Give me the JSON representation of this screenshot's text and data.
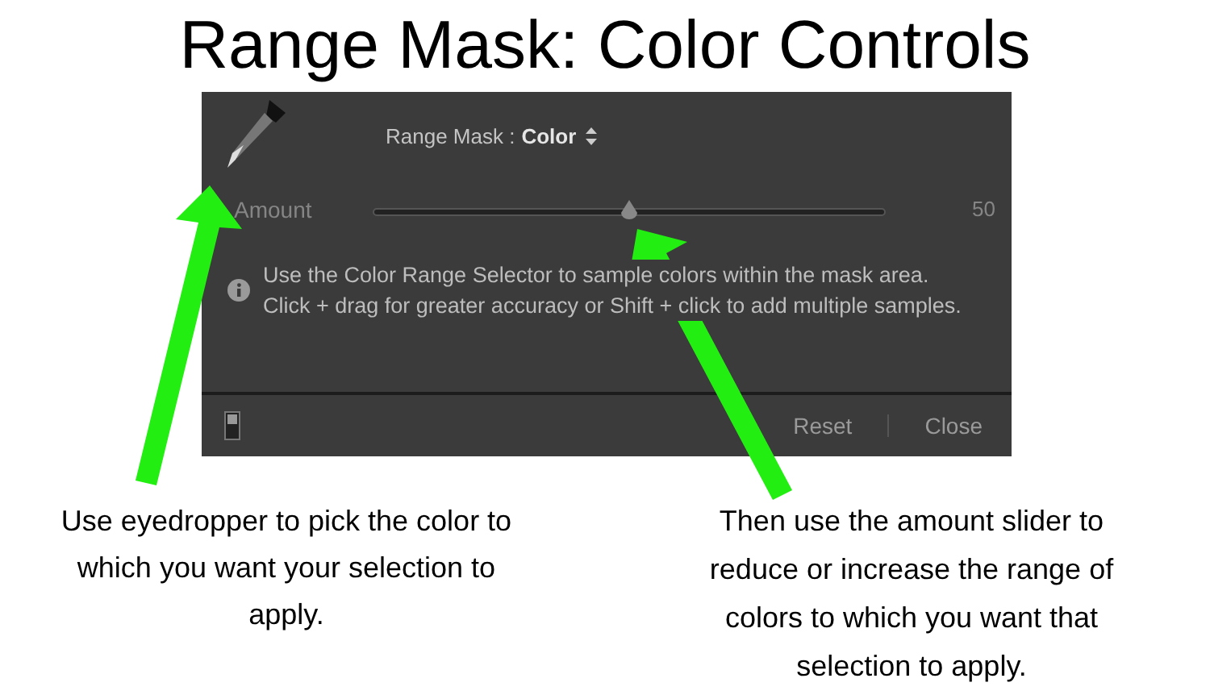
{
  "title": "Range Mask: Color Controls",
  "panel": {
    "mask_label": "Range Mask :",
    "mask_value": "Color",
    "amount": {
      "label": "Amount",
      "level": 0.5,
      "reading": "50"
    },
    "info": "Use the Color Range Selector to sample colors within the mask area. Click + drag for greater accuracy or Shift + click to add multiple samples.",
    "buttons": [
      "Reset",
      "Close"
    ]
  },
  "captions": [
    "Use eyedropper to pick the color to which you want your selection to apply.",
    "Then use the amount slider to reduce or increase the range of colors to which you want that selection to apply."
  ]
}
